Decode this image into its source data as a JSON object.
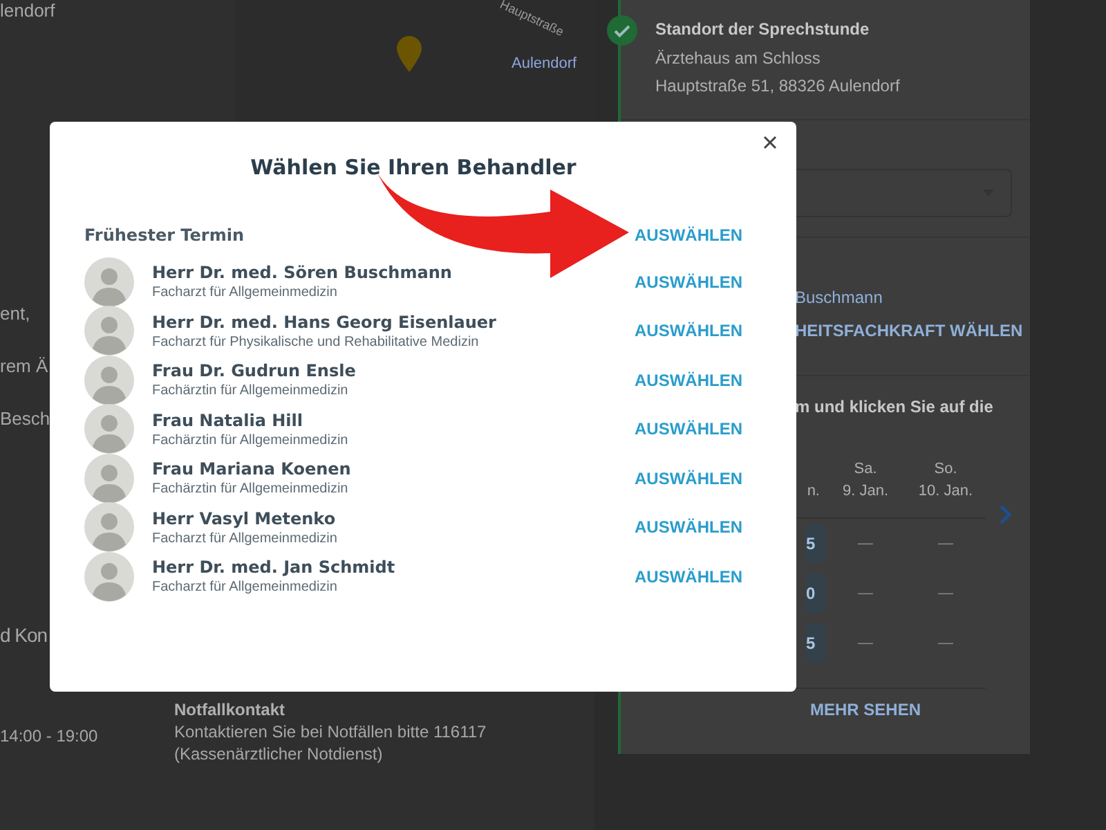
{
  "page": {
    "location_fragment": "lendorf",
    "map": {
      "town_label": "Aulendorf",
      "street_label": "Hauptstraße"
    },
    "text_fragments": [
      "ent,",
      "rem Ä",
      "Besch"
    ],
    "section_fragment": "d Kon",
    "hours": "14:00 - 19:00",
    "emergency": {
      "title": "Notfallkontakt",
      "lines": [
        "Kontaktieren Sie bei Notfällen bitte 116117",
        "(Kassenärztlicher Notdienst)"
      ]
    }
  },
  "booking_card": {
    "location": {
      "title": "Standort der Sprechstunde",
      "lines": [
        "Ärztehaus am Schloss",
        "Hauptstraße 51, 88326 Aulendorf"
      ]
    },
    "practitioner_fragment": "Buschmann",
    "choose_link": "HEITSFACHKRAFT WÄHLEN",
    "instruction_fragment": "m und klicken Sie auf die",
    "days": [
      {
        "date": "n."
      },
      {
        "weekday": "Sa.",
        "date": "9. Jan."
      },
      {
        "weekday": "So.",
        "date": "10. Jan."
      }
    ],
    "slots": [
      [
        "5",
        "—",
        "—"
      ],
      [
        "0",
        "—",
        "—"
      ],
      [
        "5",
        "—",
        "—"
      ]
    ],
    "more": "MEHR SEHEN"
  },
  "modal": {
    "title": "Wählen Sie Ihren Behandler",
    "earliest_label": "Frühester Termin",
    "earliest_button": "AUSWÄHLEN",
    "practitioners": [
      {
        "name": "Herr Dr. med. Sören Buschmann",
        "specialty": "Facharzt für Allgemeinmedizin",
        "button": "AUSWÄHLEN"
      },
      {
        "name": "Herr Dr. med. Hans Georg Eisenlauer",
        "specialty": "Facharzt für Physikalische und Rehabilitative Medizin",
        "button": "AUSWÄHLEN"
      },
      {
        "name": "Frau Dr. Gudrun Ensle",
        "specialty": "Fachärztin für Allgemeinmedizin",
        "button": "AUSWÄHLEN"
      },
      {
        "name": "Frau Natalia Hill",
        "specialty": "Fachärztin für Allgemeinmedizin",
        "button": "AUSWÄHLEN"
      },
      {
        "name": "Frau Mariana Koenen",
        "specialty": "Fachärztin für Allgemeinmedizin",
        "button": "AUSWÄHLEN"
      },
      {
        "name": "Herr Vasyl Metenko",
        "specialty": "Facharzt für Allgemeinmedizin",
        "button": "AUSWÄHLEN"
      },
      {
        "name": "Herr Dr. med. Jan Schmidt",
        "specialty": "Facharzt für Allgemeinmedizin",
        "button": "AUSWÄHLEN"
      }
    ]
  }
}
